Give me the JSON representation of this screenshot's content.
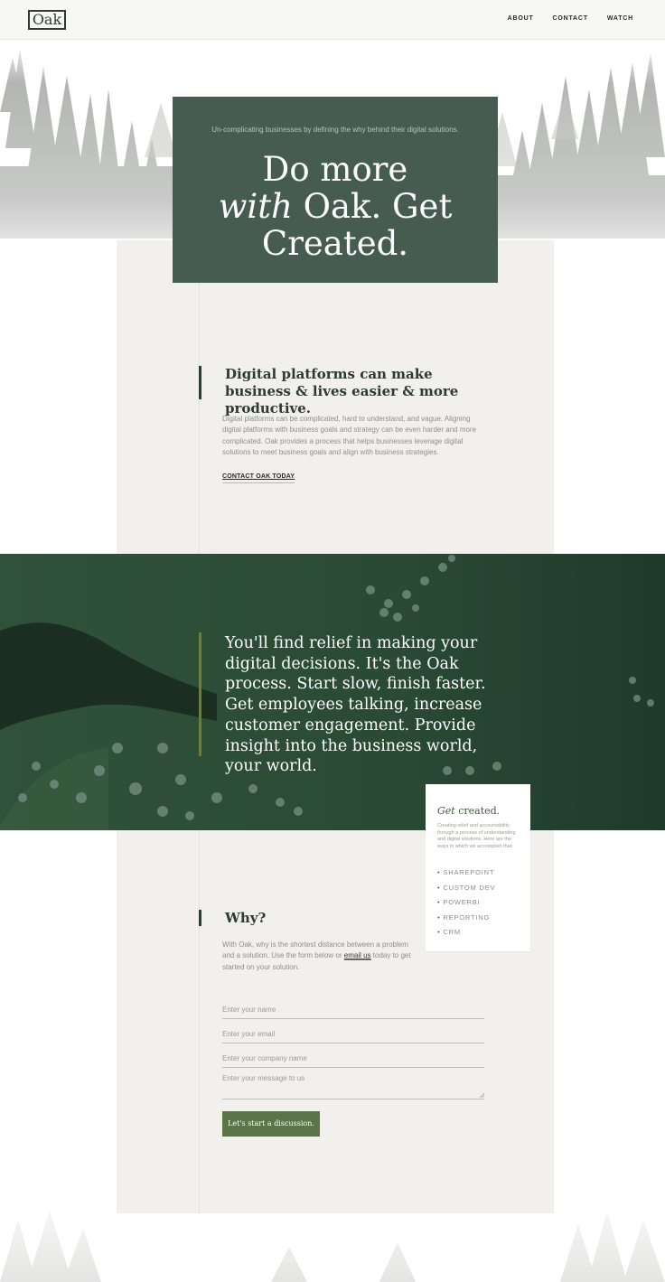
{
  "header": {
    "logo": "Oak",
    "nav": [
      "ABOUT",
      "CONTACT",
      "WATCH"
    ]
  },
  "hero": {
    "subtitle": "Un-complicating businesses by defining the why behind their digital solutions.",
    "title_line1": "Do more",
    "title_italic": "with",
    "title_line2_rest": " Oak. Get",
    "title_line3": "Created."
  },
  "intro": {
    "heading": "Digital platforms can make business & lives easier & more productive.",
    "body": "Digital platforms can be complicated, hard to understand, and vague. Aligning digital platforms with business goals and strategy can be even harder and more complicated.  Oak provides a process that helps businesses leverage digital solutions to meet business goals and align with business strategies.",
    "cta": "CONTACT OAK TODAY"
  },
  "process": {
    "text": "You'll find relief in making your digital decisions. It's the Oak process. Start slow, finish faster. Get employees talking, increase customer engagement. Provide insight into the business world, your world."
  },
  "card": {
    "title_italic": "Get",
    "title_rest": " created.",
    "description": "Creating relief and accountability through a process of understanding and digital solutions. Here are the ways in which we accomplish that:",
    "items": [
      "SHAREPOINT",
      "CUSTOM DEV",
      "POWERBI",
      "REPORTING",
      "CRM"
    ]
  },
  "why": {
    "heading": "Why?",
    "body_before": "With Oak, why is the shortest distance between a problem and a solution. Use the form below or ",
    "email_link": "email us",
    "body_after": " today to get started on your solution."
  },
  "form": {
    "name_placeholder": "Enter your name",
    "email_placeholder": "Enter your email",
    "company_placeholder": "Enter your company name",
    "message_placeholder": "Enter your message to us",
    "submit_label": "Let's start a discussion."
  },
  "colors": {
    "hero_green": "#475c51",
    "band_green": "#2c4935",
    "button_green": "#5c7548",
    "panel_beige": "#f1f0ec"
  }
}
